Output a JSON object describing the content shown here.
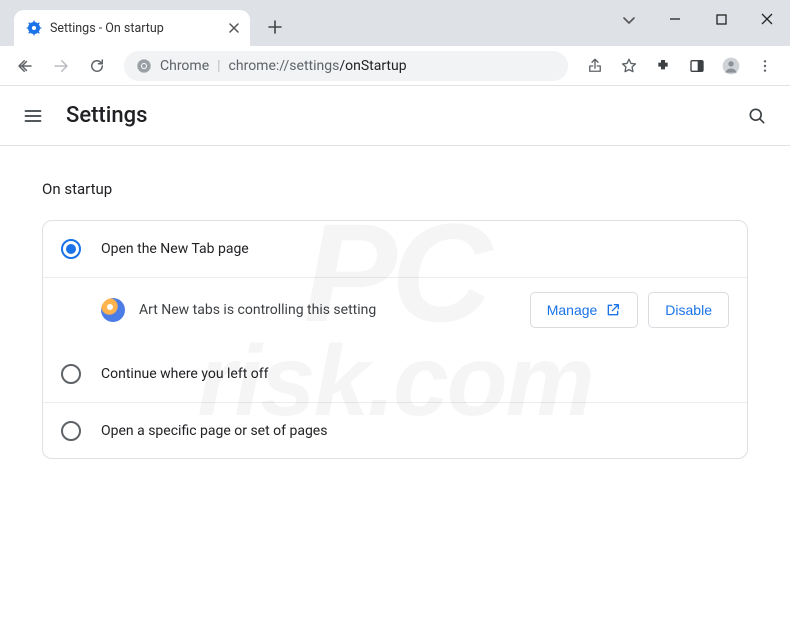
{
  "window": {
    "tab_title": "Settings - On startup"
  },
  "omnibox": {
    "scheme": "Chrome",
    "url_host": "chrome://settings",
    "url_path": "/onStartup"
  },
  "settings": {
    "title": "Settings",
    "section": "On startup",
    "options": [
      {
        "label": "Open the New Tab page",
        "selected": true
      },
      {
        "label": "Continue where you left off",
        "selected": false
      },
      {
        "label": "Open a specific page or set of pages",
        "selected": false
      }
    ],
    "extension_notice": {
      "text": "Art New tabs is controlling this setting",
      "manage_label": "Manage",
      "disable_label": "Disable"
    }
  },
  "watermark": {
    "line1": "PC",
    "line2": "risk.com"
  }
}
